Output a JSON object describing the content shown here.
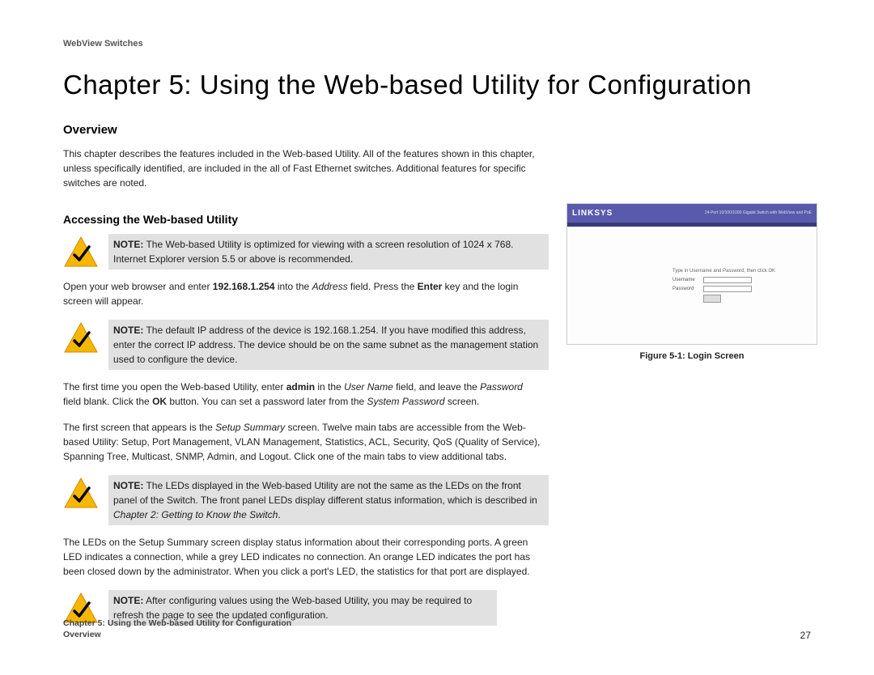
{
  "header": "WebView Switches",
  "chapter_title": "Chapter 5: Using the Web-based Utility for Configuration",
  "section_overview": "Overview",
  "overview_p1": "This chapter describes the features included in the Web-based Utility. All of the features shown in this chapter, unless specifically identified, are included in the all of Fast Ethernet switches. Additional features for specific switches are noted.",
  "section_accessing": "Accessing the Web-based Utility",
  "note1_prefix": "NOTE:",
  "note1_text": " The Web-based Utility is optimized for viewing with a screen resolution of 1024 x 768. Internet Explorer version 5.5 or above is recommended.",
  "p_open_1": "Open your web browser and enter ",
  "p_open_ip": "192.168.1.254",
  "p_open_2": " into the ",
  "p_open_address": "Address",
  "p_open_3": " field. Press the ",
  "p_open_enter": "Enter",
  "p_open_4": " key and the login screen will appear.",
  "note2_prefix": "NOTE:",
  "note2_text": " The default IP address of the device is 192.168.1.254. If you have modified this address, enter the correct IP address. The device should be on the same subnet as the management station used to configure the device.",
  "p_first_1": "The first time you open the Web-based Utility, enter ",
  "p_first_admin": "admin",
  "p_first_2": " in the ",
  "p_first_username": "User Name",
  "p_first_3": " field, and leave the ",
  "p_first_password": "Password",
  "p_first_4": " field blank. Click the ",
  "p_first_ok": "OK",
  "p_first_5": " button. You can set a password later from the ",
  "p_first_syspass": "System Password",
  "p_first_6": " screen.",
  "p_screen_1": "The first screen that appears is the ",
  "p_screen_setup": "Setup Summary",
  "p_screen_2": " screen. Twelve main tabs are accessible from the Web-based Utility: Setup, Port Management, VLAN Management, Statistics, ACL, Security, QoS (Quality of Service), Spanning Tree, Multicast, SNMP, Admin, and Logout. Click one of the main tabs to view additional tabs.",
  "note3_prefix": "NOTE:",
  "note3_text1": " The LEDs displayed in the Web-based Utility are not the same as the LEDs on the front panel of the Switch. The front panel LEDs display different status information, which is described in ",
  "note3_ital": "Chapter 2: Getting to Know the Switch",
  "note3_text2": ".",
  "p_leds": "The LEDs on the Setup Summary screen display status information about their corresponding ports. A green LED indicates a connection, while a grey LED indicates no connection. An orange LED indicates the port has been closed down by the administrator. When you click a port's LED, the statistics for that port are displayed.",
  "note4_prefix": "NOTE:",
  "note4_text": " After configuring values using the Web-based Utility, you may be required to refresh the page to see the updated configuration.",
  "figure_linksys": "LINKSYS",
  "figure_caption": "Figure 5-1: Login Screen",
  "footer_line1": "Chapter 5: Using the Web-based Utility for Configuration",
  "footer_line2": "Overview",
  "page_number": "27"
}
